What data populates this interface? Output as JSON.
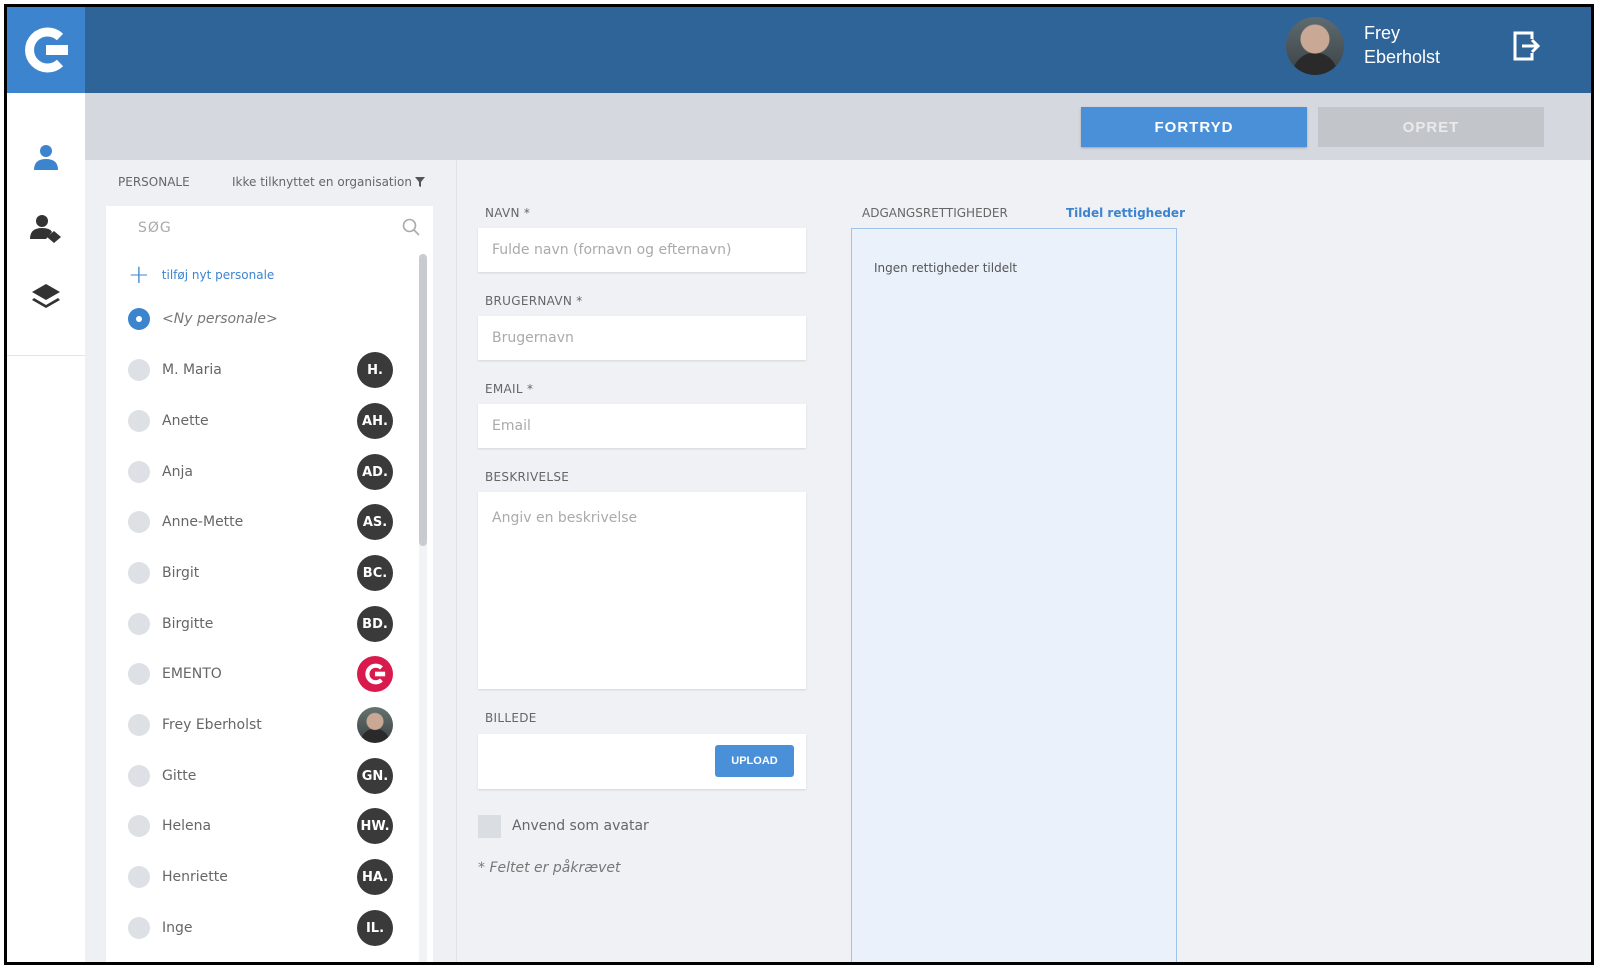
{
  "header": {
    "user_name": "Frey Eberholst",
    "user_first": "Frey",
    "user_last": "Eberholst"
  },
  "actions": {
    "cancel_label": "FORTRYD",
    "create_label": "OPRET"
  },
  "staff": {
    "title": "PERSONALE",
    "filter_label": "Ikke tilknyttet en organisation",
    "search_placeholder": "SØG",
    "add_label": "tilføj nyt personale",
    "new_item_label": "<Ny personale>",
    "items": [
      {
        "name": "M. Maria",
        "initials": "H."
      },
      {
        "name": "Anette",
        "initials": "AH."
      },
      {
        "name": "Anja",
        "initials": "AD."
      },
      {
        "name": "Anne-Mette",
        "initials": "AS."
      },
      {
        "name": "Birgit",
        "initials": "BC."
      },
      {
        "name": "Birgitte",
        "initials": "BD."
      },
      {
        "name": "EMENTO",
        "initials": ""
      },
      {
        "name": "Frey Eberholst",
        "initials": ""
      },
      {
        "name": "Gitte",
        "initials": "GN."
      },
      {
        "name": "Helena",
        "initials": "HW."
      },
      {
        "name": "Henriette",
        "initials": "HA."
      },
      {
        "name": "Inge",
        "initials": "IL."
      }
    ]
  },
  "form": {
    "name_label": "NAVN *",
    "name_placeholder": "Fulde navn (fornavn og efternavn)",
    "username_label": "BRUGERNAVN *",
    "username_placeholder": "Brugernavn",
    "email_label": "EMAIL *",
    "email_placeholder": "Email",
    "description_label": "BESKRIVELSE",
    "description_placeholder": "Angiv en beskrivelse",
    "image_label": "BILLEDE",
    "upload_label": "UPLOAD",
    "avatar_checkbox_label": "Anvend som avatar",
    "required_note": "* Feltet er påkrævet"
  },
  "rights": {
    "title": "ADGANGSRETTIGHEDER",
    "assign_link": "Tildel rettigheder",
    "empty_text": "Ingen rettigheder tildelt"
  },
  "colors": {
    "topbar": "#2f6499",
    "accent": "#4a90d9",
    "brand": "#d91a4c"
  },
  "icons": [
    "app-logo-icon",
    "logout-icon",
    "person-icon",
    "person-role-icon",
    "layers-icon",
    "search-icon",
    "filter-icon",
    "plus-icon"
  ]
}
